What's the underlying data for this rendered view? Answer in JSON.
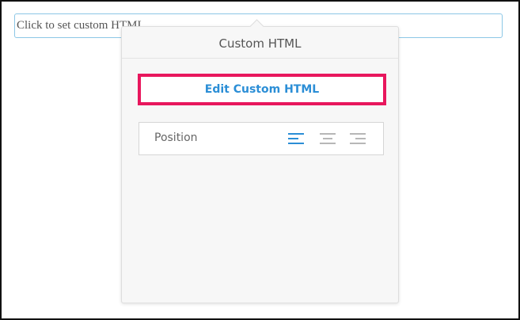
{
  "custom_field": {
    "placeholder_text": "Click to set custom HTML"
  },
  "popover": {
    "title": "Custom HTML",
    "edit_button_label": "Edit Custom HTML",
    "position": {
      "label": "Position",
      "options": [
        "align-left",
        "align-center",
        "align-right"
      ],
      "selected": "align-left"
    }
  },
  "colors": {
    "accent_blue": "#2b8ed6",
    "highlight_border": "#e8175d",
    "inactive_icon": "#b7b7b7",
    "field_border": "#8cc7e6"
  }
}
